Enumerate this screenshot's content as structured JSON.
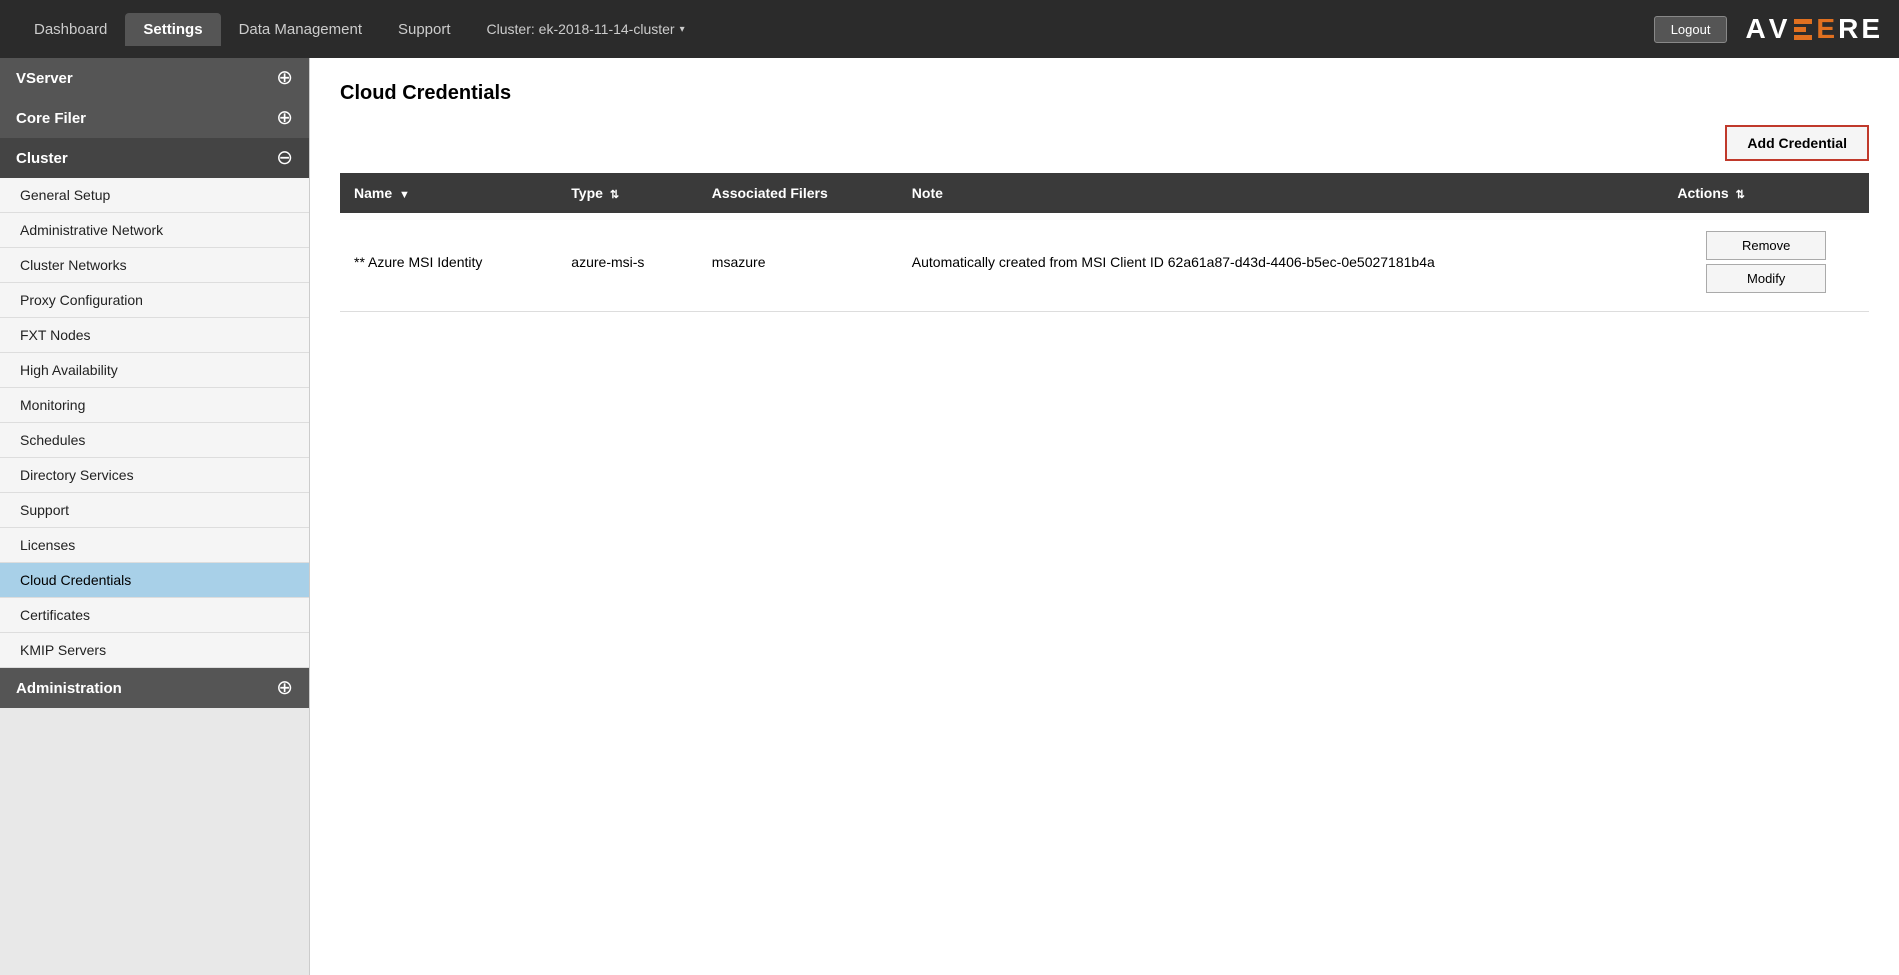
{
  "topbar": {
    "tabs": [
      {
        "label": "Dashboard",
        "active": false
      },
      {
        "label": "Settings",
        "active": true
      },
      {
        "label": "Data Management",
        "active": false
      },
      {
        "label": "Support",
        "active": false
      }
    ],
    "cluster_label": "Cluster: ek-2018-11-14-cluster",
    "logout_label": "Logout",
    "logo_text": "AVERE"
  },
  "sidebar": {
    "sections": [
      {
        "label": "VServer",
        "expanded": false,
        "icon": "plus",
        "items": []
      },
      {
        "label": "Core Filer",
        "expanded": false,
        "icon": "plus",
        "items": []
      },
      {
        "label": "Cluster",
        "expanded": true,
        "icon": "minus",
        "items": [
          {
            "label": "General Setup",
            "active": false
          },
          {
            "label": "Administrative Network",
            "active": false
          },
          {
            "label": "Cluster Networks",
            "active": false
          },
          {
            "label": "Proxy Configuration",
            "active": false
          },
          {
            "label": "FXT Nodes",
            "active": false
          },
          {
            "label": "High Availability",
            "active": false
          },
          {
            "label": "Monitoring",
            "active": false
          },
          {
            "label": "Schedules",
            "active": false
          },
          {
            "label": "Directory Services",
            "active": false
          },
          {
            "label": "Support",
            "active": false
          },
          {
            "label": "Licenses",
            "active": false
          },
          {
            "label": "Cloud Credentials",
            "active": true
          },
          {
            "label": "Certificates",
            "active": false
          },
          {
            "label": "KMIP Servers",
            "active": false
          }
        ]
      },
      {
        "label": "Administration",
        "expanded": false,
        "icon": "plus",
        "items": []
      }
    ]
  },
  "content": {
    "page_title": "Cloud Credentials",
    "add_credential_label": "Add Credential",
    "table": {
      "columns": [
        {
          "label": "Name",
          "sortable": true
        },
        {
          "label": "Type",
          "sortable": true
        },
        {
          "label": "Associated Filers",
          "sortable": false
        },
        {
          "label": "Note",
          "sortable": false
        },
        {
          "label": "Actions",
          "sortable": true
        }
      ],
      "rows": [
        {
          "name": "** Azure MSI Identity",
          "type": "azure-msi-s",
          "associated_filers": "msazure",
          "note": "Automatically created from MSI Client ID 62a61a87-d43d-4406-b5ec-0e5027181b4a",
          "actions": [
            "Remove",
            "Modify"
          ]
        }
      ]
    }
  }
}
